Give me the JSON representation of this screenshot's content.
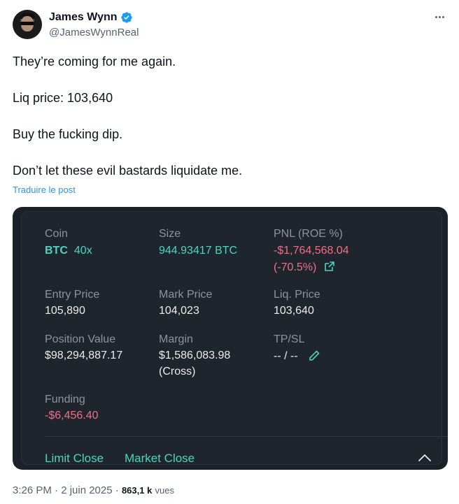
{
  "author": {
    "display_name": "James Wynn",
    "handle": "@JamesWynnReal"
  },
  "tweet": {
    "lines": [
      "They’re coming for me again.",
      "Liq price: 103,640",
      "Buy the fucking dip.",
      "Don’t let these evil bastards liquidate me."
    ],
    "translate_label": "Traduire le post"
  },
  "position": {
    "coin_label": "Coin",
    "coin": "BTC",
    "leverage": "40x",
    "size_label": "Size",
    "size": "944.93417 BTC",
    "pnl_label": "PNL (ROE %)",
    "pnl": "-$1,764,568.04",
    "roe": "(-70.5%)",
    "entry_label": "Entry Price",
    "entry": "105,890",
    "mark_label": "Mark Price",
    "mark": "104,023",
    "liq_label": "Liq. Price",
    "liq": "103,640",
    "value_label": "Position Value",
    "value": "$98,294,887.17",
    "margin_label": "Margin",
    "margin": "$1,586,083.98",
    "margin_mode": "(Cross)",
    "tpsl_label": "TP/SL",
    "tpsl": "-- / --",
    "funding_label": "Funding",
    "funding": "-$6,456.40",
    "limit_close": "Limit Close",
    "market_close": "Market Close"
  },
  "meta": {
    "time_date": "3:26 PM · 2 juin 2025 ·",
    "views_count": "863,1 k",
    "views_label": "vues"
  },
  "colors": {
    "accent_green": "#50d2c1",
    "negative_red": "#ed7088",
    "link_blue": "#1d9bf0",
    "card_bg": "#1b2129"
  }
}
